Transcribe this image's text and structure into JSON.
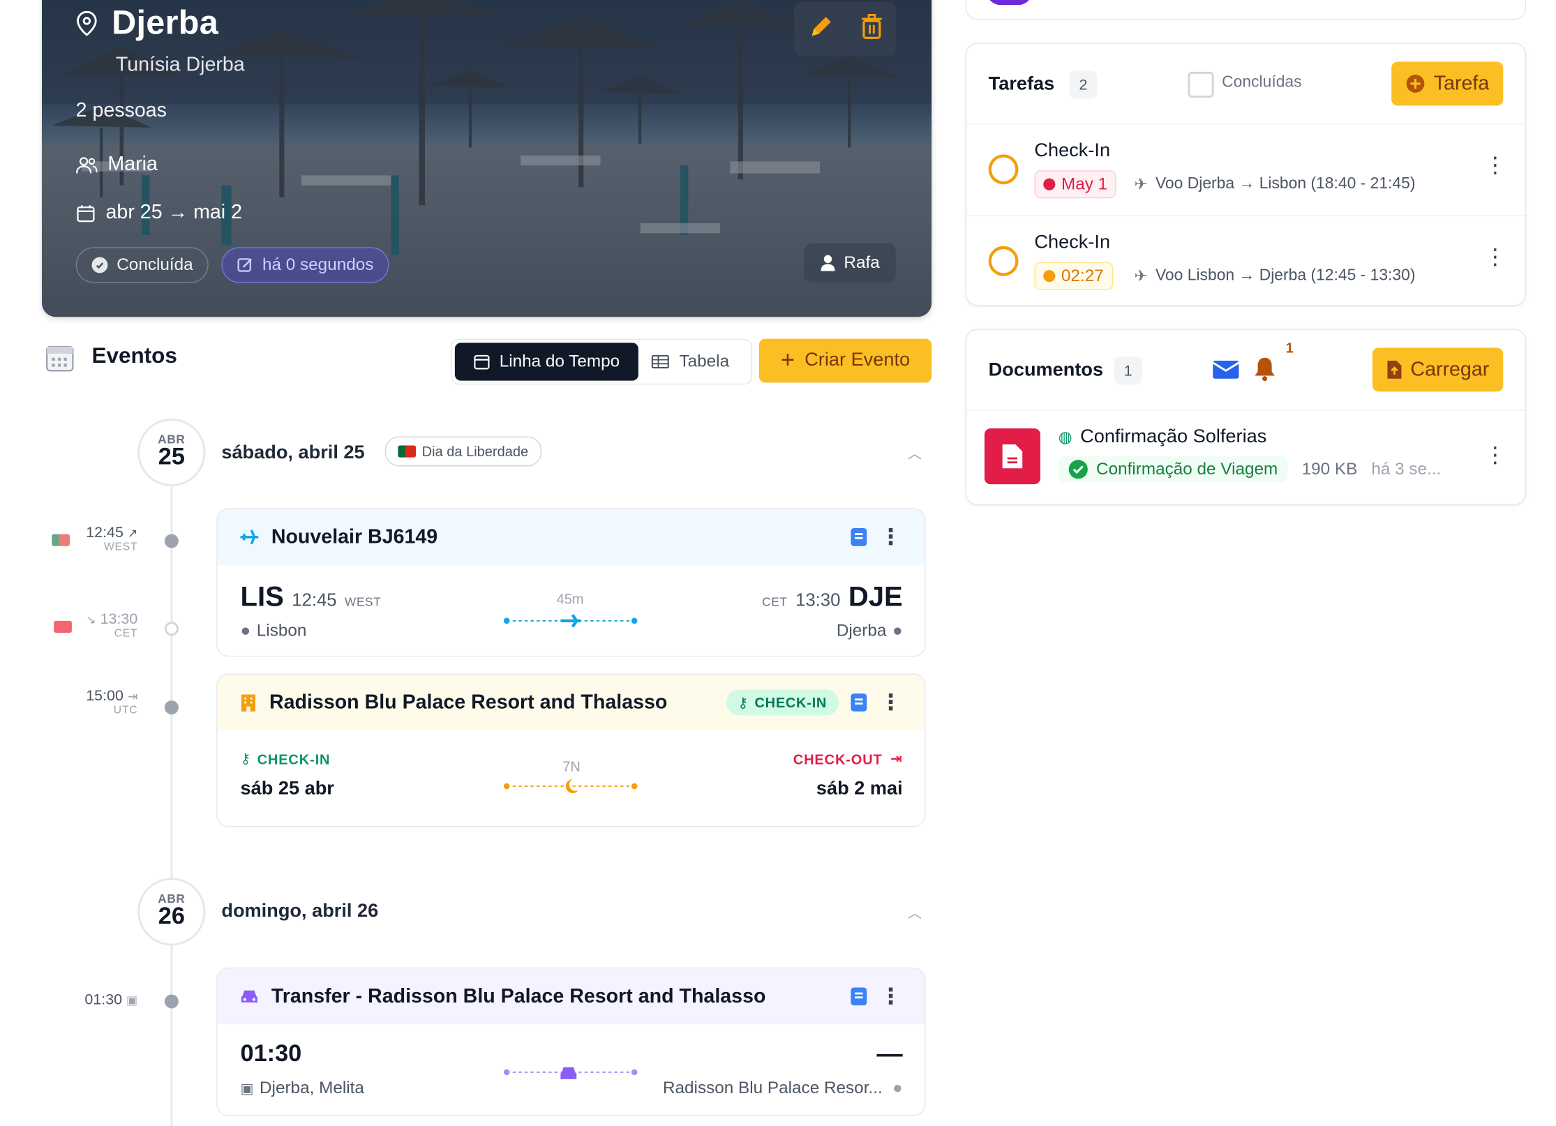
{
  "trip": {
    "title": "Djerba",
    "subtitle": "Tunísia Djerba",
    "people": "2 pessoas",
    "member": "Maria",
    "dates": "abr 25 → mai 2",
    "status": "Concluída",
    "edited": "há 0 segundos",
    "owner": "Rafa"
  },
  "events": {
    "title": "Eventos",
    "view_timeline": "Linha do Tempo",
    "view_table": "Tabela",
    "create": "Criar Evento"
  },
  "days": [
    {
      "month": "ABR",
      "day": "25",
      "label": "sábado, abril 25",
      "holiday": "Dia da Liberdade"
    },
    {
      "month": "ABR",
      "day": "26",
      "label": "domingo, abril 26"
    }
  ],
  "timeline_times": [
    {
      "time": "12:45",
      "tz": "WEST"
    },
    {
      "time": "13:30",
      "tz": "CET"
    },
    {
      "time": "15:00",
      "tz": "UTC"
    },
    {
      "time": "01:30"
    }
  ],
  "flight": {
    "title": "Nouvelair BJ6149",
    "from_code": "LIS",
    "from_time": "12:45",
    "from_tz": "WEST",
    "from_city": "Lisbon",
    "duration": "45m",
    "to_code": "DJE",
    "to_time": "13:30",
    "to_tz": "CET",
    "to_city": "Djerba"
  },
  "hotel": {
    "title": "Radisson Blu Palace Resort and Thalasso",
    "badge": "CHECK-IN",
    "checkin_label": "CHECK-IN",
    "checkin_date": "sáb 25 abr",
    "nights": "7N",
    "checkout_label": "CHECK-OUT",
    "checkout_date": "sáb 2 mai"
  },
  "transfer": {
    "title": "Transfer - Radisson Blu Palace Resort and Thalasso",
    "time": "01:30",
    "end": "—",
    "from": "Djerba, Melita",
    "to": "Radisson Blu Palace Resor..."
  },
  "tasks": {
    "title": "Tarefas",
    "count": "2",
    "filter": "Concluídas",
    "add": "Tarefa",
    "items": [
      {
        "name": "Check-In",
        "chip": "May 1",
        "route": "Voo Djerba → Lisbon (18:40 - 21:45)"
      },
      {
        "name": "Check-In",
        "chip": "02:27",
        "route": "Voo Lisbon → Djerba (12:45 - 13:30)"
      }
    ]
  },
  "documents": {
    "title": "Documentos",
    "count": "1",
    "notif": "1",
    "upload": "Carregar",
    "items": [
      {
        "name": "Confirmação Solferias",
        "tag": "Confirmação de Viagem",
        "size": "190 KB",
        "age": "há 3 se..."
      }
    ]
  },
  "colors": {
    "accent": "#fbbf24",
    "flight": "#0ea5e9",
    "hotel": "#f59e0b",
    "transfer": "#8b5cf6",
    "danger": "#e11d48",
    "success": "#16a34a"
  }
}
